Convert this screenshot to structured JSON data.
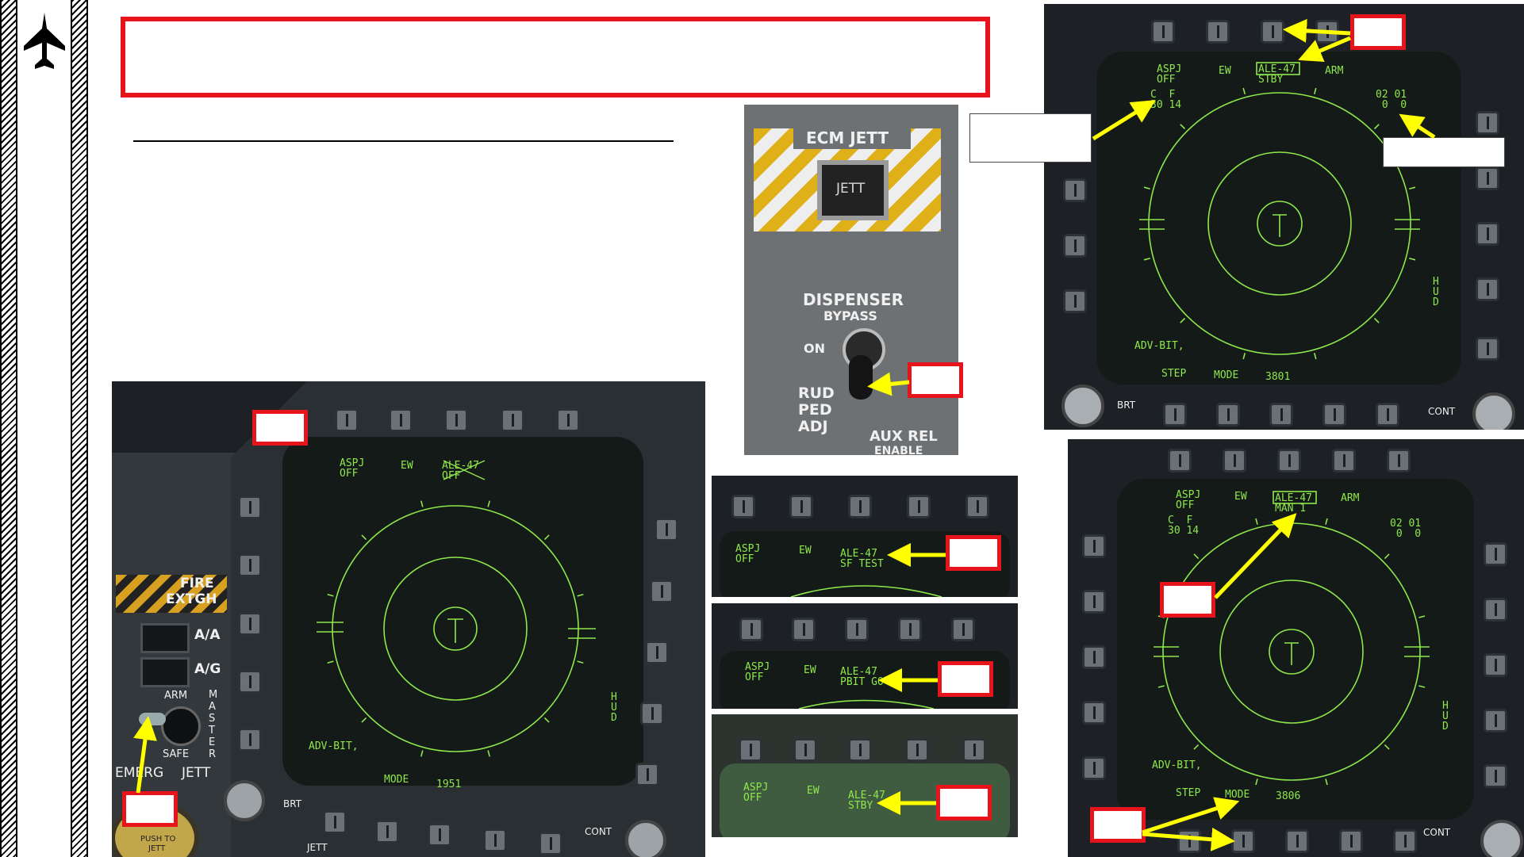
{
  "slide": {
    "title": "",
    "subtitle": "",
    "colors": {
      "accent_red": "#e8141c",
      "arrow_yellow": "#ffff00",
      "mfd_green": "#8ee84b"
    },
    "sidebar_icon": "jet-silhouette-icon"
  },
  "ecm_panel": {
    "header": "ECM JETT",
    "jett_button": "JETT",
    "dispenser": "DISPENSER",
    "bypass": "BYPASS",
    "on": "ON",
    "rud": "RUD",
    "ped": "PED",
    "adj": "ADJ",
    "aux": "AUX REL",
    "enable": "ENABLE"
  },
  "left_panel": {
    "fire": "FIRE",
    "extgh": "EXTGH",
    "aa": "A/A",
    "ag": "A/G",
    "arm": "ARM",
    "safe": "SAFE",
    "master": "MASTER",
    "emerg": "EMERG",
    "jett": "JETT",
    "push_to": "PUSH TO",
    "push_jett": "JETT",
    "jett_bottom": "JETT"
  },
  "mfd_main": {
    "aspj": "ASPJ\nOFF",
    "ew": "EW",
    "ale": "ALE-47\nOFF",
    "adv_bit": "ADV-BIT,",
    "mode": "MODE",
    "mode_value": "1951",
    "hud": "H\nU\nD",
    "brt": "BRT",
    "cont": "CONT"
  },
  "mfd_top_right": {
    "aspj": "ASPJ\nOFF",
    "ew": "EW",
    "ale": "ALE-47\nSTBY",
    "arm": "ARM",
    "cf": "C  F\n30 14",
    "counts": "02 01\n 0  0",
    "adv_bit": "ADV-BIT,",
    "step": "STEP",
    "mode": "MODE",
    "mode_value": "3801",
    "hud": "H\nU\nD",
    "brt": "BRT",
    "cont": "CONT"
  },
  "mfd_bottom_right": {
    "aspj": "ASPJ\nOFF",
    "ew": "EW",
    "ale": "ALE-47\nMAN 1",
    "arm": "ARM",
    "cf": "C  F\n30 14",
    "counts": "02 01\n 0  0",
    "adv_bit": "ADV-BIT,",
    "step": "STEP",
    "mode": "MODE",
    "mode_value": "3806",
    "hud": "H\nU\nD",
    "cont": "CONT"
  },
  "strips": [
    {
      "aspj": "ASPJ\nOFF",
      "ew": "EW",
      "ale": "ALE-47\nSF TEST"
    },
    {
      "aspj": "ASPJ\nOFF",
      "ew": "EW",
      "ale": "ALE-47\nPBIT GO"
    },
    {
      "aspj": "ASPJ\nOFF",
      "ew": "EW",
      "ale": "ALE-47\nSTBY"
    }
  ]
}
